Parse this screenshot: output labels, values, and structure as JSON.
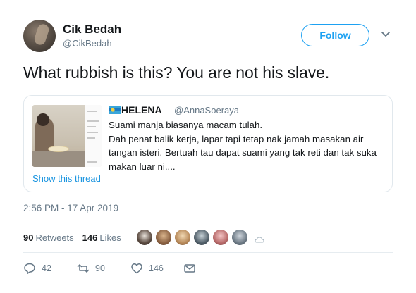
{
  "author": {
    "display_name": "Cik Bedah",
    "handle": "@CikBedah"
  },
  "follow_label": "Follow",
  "tweet_text": "What rubbish is this? You are not his slave.",
  "quoted": {
    "display_name": "HELENA",
    "handle": "@AnnaSoeraya",
    "text_lines": [
      "Suami manja biasanya macam tulah.",
      "Dah penat balik kerja, lapar tapi tetap nak jamah masakan air",
      "tangan isteri. Bertuah tau dapat suami yang tak reti dan tak suka",
      "makan luar ni...."
    ],
    "show_thread": "Show this thread"
  },
  "timestamp": "2:56 PM - 17 Apr 2019",
  "stats": {
    "retweets_count": "90",
    "retweets_label": "Retweets",
    "likes_count": "146",
    "likes_label": "Likes"
  },
  "actions": {
    "replies": "42",
    "retweets": "90",
    "likes": "146"
  },
  "icons": [
    "chevron-down-icon",
    "flag-icon",
    "reply-icon",
    "retweet-icon",
    "like-icon",
    "message-icon",
    "more-icon"
  ],
  "colors": {
    "accent": "#1da1f2",
    "link": "#1b95e0",
    "secondary_text": "#657786",
    "border": "#e1e8ed"
  }
}
